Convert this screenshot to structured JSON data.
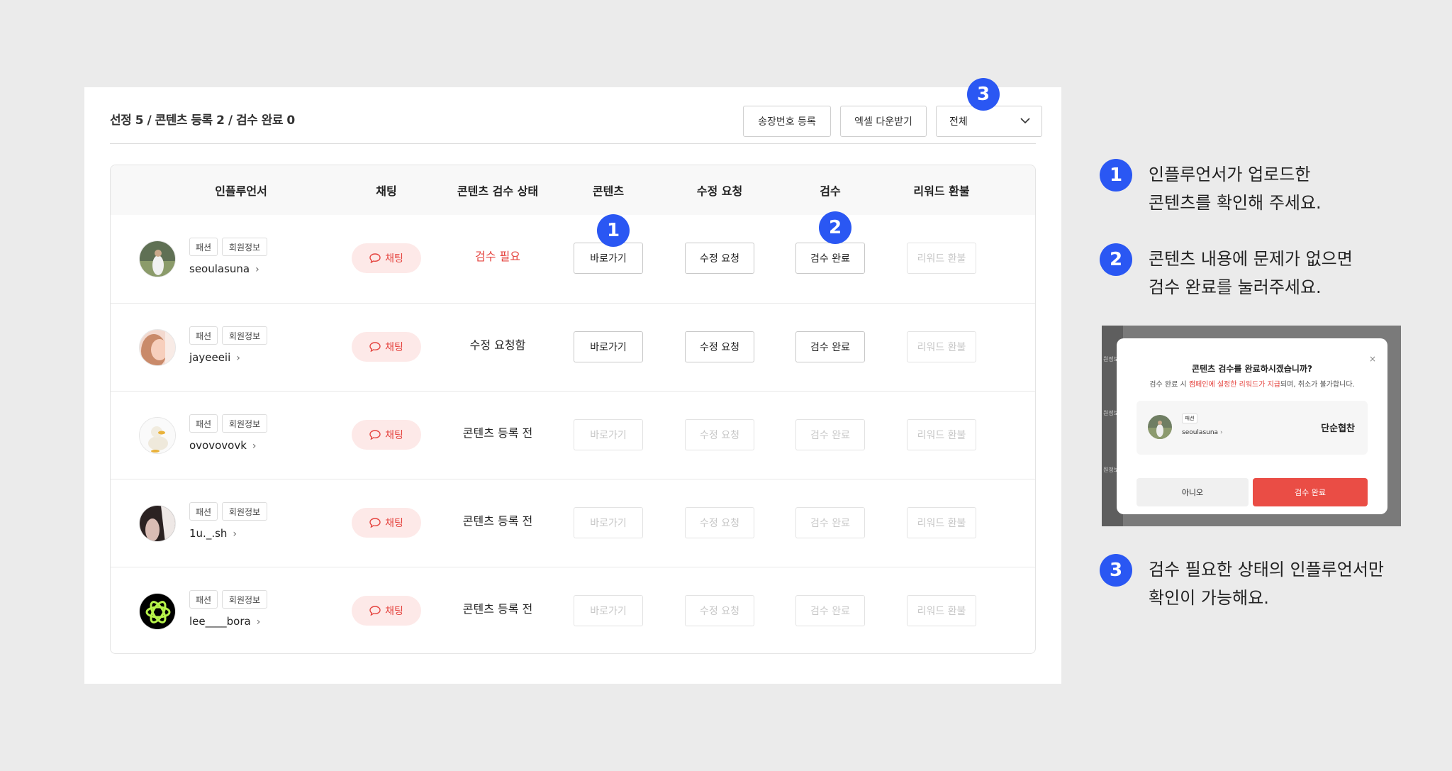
{
  "header": {
    "summary": "선정 5 / 콘텐츠 등록 2 / 검수 완료 0",
    "ship_btn": "송장번호 등록",
    "excel_btn": "엑셀 다운받기",
    "filter_value": "전체"
  },
  "columns": [
    "인플루언서",
    "채팅",
    "콘텐츠 검수 상태",
    "콘텐츠",
    "수정 요청",
    "검수",
    "리워드 환불"
  ],
  "rows": [
    {
      "category": "패션",
      "info": "회원정보",
      "username": "seoulasuna",
      "chat": "채팅",
      "status": "검수 필요",
      "status_color": "#e5443f",
      "content_btn": "바로가기",
      "revise_btn": "수정 요청",
      "review_btn": "검수 완료",
      "refund_btn": "리워드 환불",
      "avatar": "avatar-garden"
    },
    {
      "category": "패션",
      "info": "회원정보",
      "username": "jayeeeii",
      "chat": "채팅",
      "status": "수정 요청함",
      "status_color": "#222222",
      "content_btn": "바로가기",
      "revise_btn": "수정 요청",
      "review_btn": "검수 완료",
      "refund_btn": "리워드 환불",
      "avatar": "avatar-portrait"
    },
    {
      "category": "패션",
      "info": "회원정보",
      "username": "ovovovovk",
      "chat": "채팅",
      "status": "콘텐츠 등록 전",
      "status_color": "#222222",
      "content_btn": "바로가기",
      "revise_btn": "수정 요청",
      "review_btn": "검수 완료",
      "refund_btn": "리워드 환불",
      "avatar": "avatar-duck"
    },
    {
      "category": "패션",
      "info": "회원정보",
      "username": "1u._.sh",
      "chat": "채팅",
      "status": "콘텐츠 등록 전",
      "status_color": "#222222",
      "content_btn": "바로가기",
      "revise_btn": "수정 요청",
      "review_btn": "검수 완료",
      "refund_btn": "리워드 환불",
      "avatar": "avatar-dark"
    },
    {
      "category": "패션",
      "info": "회원정보",
      "username": "lee____bora",
      "chat": "채팅",
      "status": "콘텐츠 등록 전",
      "status_color": "#222222",
      "content_btn": "바로가기",
      "revise_btn": "수정 요청",
      "review_btn": "검수 완료",
      "refund_btn": "리워드 환불",
      "avatar": "avatar-atom"
    }
  ],
  "badges": [
    "1",
    "2",
    "3"
  ],
  "notes": {
    "n1_line1": "인플루언서가 업로드한",
    "n1_line2": "콘텐츠를 확인해 주세요.",
    "n2_line1": "콘텐츠 내용에 문제가 없으면",
    "n2_line2": "검수 완료를 눌러주세요.",
    "n3_line1": "검수 필요한 상태의 인플루언서만",
    "n3_line2": "확인이 가능해요."
  },
  "modal": {
    "title": "콘텐츠 검수를 완료하시겠습니까?",
    "close": "×",
    "sub_pre": "검수 완료 시 ",
    "sub_highlight": "캠페인에 설정한 리워드가 지급",
    "sub_post": "되며, 취소가 불가합니다.",
    "tag": "패션",
    "username": "seoulasuna",
    "type": "단순협찬",
    "no_btn": "아니오",
    "yes_btn": "검수 완료",
    "edge_labels": [
      "원정보",
      "원정보",
      "원정보"
    ]
  },
  "colors": {
    "accent": "#2a57f3",
    "danger": "#e5443f",
    "chat_bg": "#fde9e8"
  }
}
